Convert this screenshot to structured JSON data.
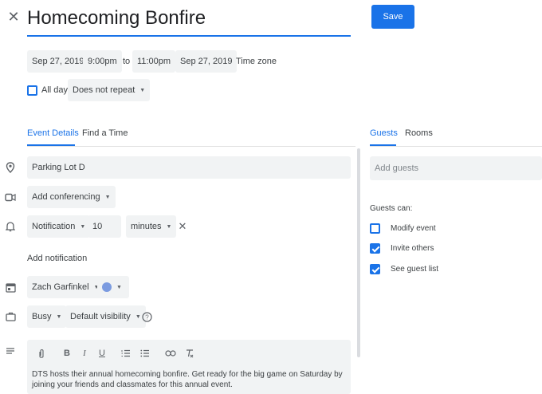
{
  "header": {
    "title": "Homecoming Bonfire",
    "save_label": "Save"
  },
  "datetime": {
    "start_date": "Sep 27, 2019",
    "start_time": "9:00pm",
    "to_label": "to",
    "end_time": "11:00pm",
    "end_date": "Sep 27, 2019",
    "timezone_label": "Time zone"
  },
  "options": {
    "all_day_label": "All day",
    "all_day_checked": false,
    "repeat_value": "Does not repeat"
  },
  "tabs": {
    "details": "Event Details",
    "find_time": "Find a Time"
  },
  "details": {
    "location": "Parking Lot D",
    "conferencing": "Add conferencing",
    "notification_type": "Notification",
    "notification_value": "10",
    "notification_unit": "minutes",
    "add_notification": "Add notification",
    "calendar_owner": "Zach Garfinkel",
    "event_color": "#7b9be0",
    "status": "Busy",
    "visibility": "Default visibility",
    "description": "DTS hosts their annual homecoming bonfire. Get ready for the big game on Saturday by joining your friends and classmates for this annual event."
  },
  "guests_panel": {
    "tab_guests": "Guests",
    "tab_rooms": "Rooms",
    "add_guests_placeholder": "Add guests",
    "guests_can_label": "Guests can:",
    "permissions": [
      {
        "label": "Modify event",
        "checked": false
      },
      {
        "label": "Invite others",
        "checked": true
      },
      {
        "label": "See guest list",
        "checked": true
      }
    ]
  },
  "colors": {
    "accent": "#1a73e8",
    "field_bg": "#f1f3f4"
  }
}
